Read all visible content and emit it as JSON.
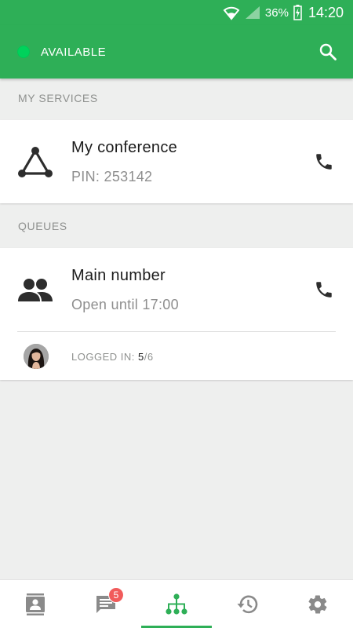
{
  "status_bar": {
    "battery": "36%",
    "time": "14:20"
  },
  "app_bar": {
    "presence_label": "AVAILABLE",
    "presence_color": "#00d25b",
    "accent_color": "#2eaf57"
  },
  "sections": {
    "services_header": "MY SERVICES",
    "queues_header": "QUEUES"
  },
  "services": [
    {
      "title": "My conference",
      "subtitle": "PIN: 253142",
      "icon": "conference-triangle-icon"
    }
  ],
  "queues": [
    {
      "title": "Main number",
      "subtitle": "Open until 17:00",
      "icon": "group-icon",
      "logged_in_label": "LOGGED IN: ",
      "logged_in_count": "5",
      "logged_in_total": "/6"
    }
  ],
  "bottom_nav": {
    "items": [
      "contacts-icon",
      "messages-icon",
      "hierarchy-icon",
      "history-icon",
      "settings-icon"
    ],
    "active_index": 2,
    "messages_badge": "5"
  }
}
